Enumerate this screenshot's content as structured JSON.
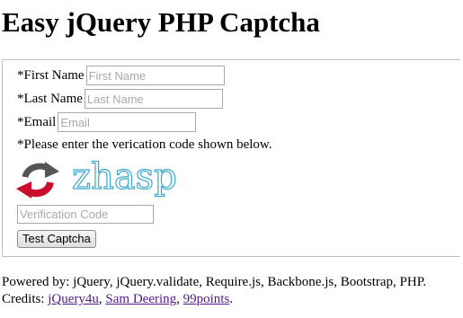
{
  "page": {
    "title": "Easy jQuery PHP Captcha"
  },
  "form": {
    "first_name": {
      "label": "*First Name",
      "placeholder": "First Name",
      "value": ""
    },
    "last_name": {
      "label": "*Last Name",
      "placeholder": "Last Name",
      "value": ""
    },
    "email": {
      "label": "*Email",
      "placeholder": "Email",
      "value": ""
    },
    "instruction": "*Please enter the verication code shown below.",
    "captcha": {
      "text": "zhasp",
      "refresh_icon": "refresh-icon"
    },
    "verification": {
      "placeholder": "Verification Code",
      "value": ""
    },
    "submit_label": "Test Captcha"
  },
  "footer": {
    "powered_by": "Powered by: jQuery, jQuery.validate, Require.js, Backbone.js, Bootstrap, PHP.",
    "credits_prefix": "Credits: ",
    "links": [
      {
        "label": "jQuery4u"
      },
      {
        "label": "Sam Deering"
      },
      {
        "label": "99points"
      }
    ],
    "separator": ", ",
    "end": "."
  },
  "colors": {
    "refresh_red": "#c8102e",
    "refresh_gray": "#555555",
    "captcha_stroke": "#3aa8cc",
    "link": "#551a8b"
  }
}
